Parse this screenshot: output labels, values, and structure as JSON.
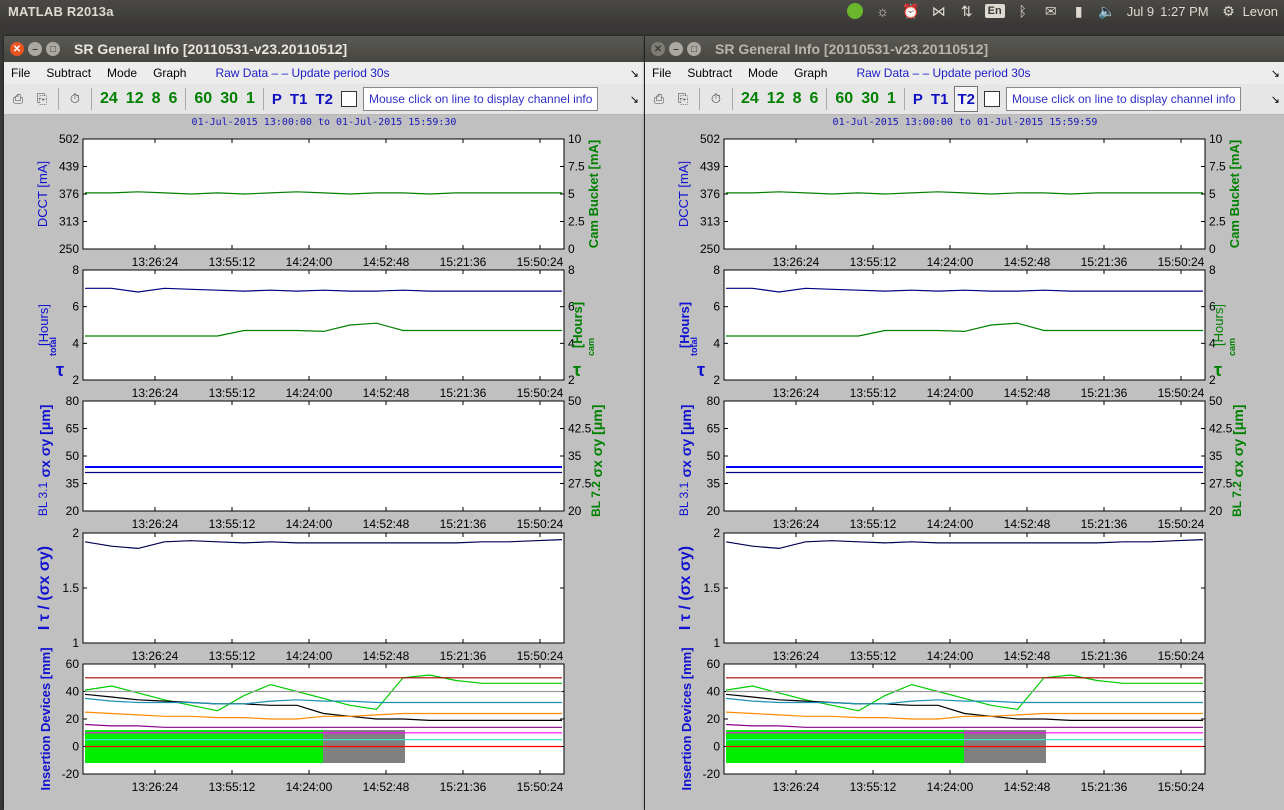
{
  "os": {
    "app_title": "MATLAB R2013a",
    "keyboard_lang": "En",
    "date": "Jul 9",
    "time": "1:27 PM",
    "user": "Levon",
    "tray_icons": [
      "spotify-icon",
      "lightbulb-icon",
      "alarm-clock-icon",
      "network-icon",
      "transfer-icon",
      "keyboard-lang-icon",
      "bluetooth-icon",
      "mail-icon",
      "battery-icon",
      "volume-icon"
    ]
  },
  "windows": [
    {
      "title": "SR General Info [20110531-v23.20110512]",
      "menus": [
        "File",
        "Subtract",
        "Mode",
        "Graph"
      ],
      "raw_label": "Raw Data – – Update period 30s",
      "period_buttons": [
        "24",
        "12",
        "8",
        "6"
      ],
      "refresh_buttons": [
        "60",
        "30",
        "1"
      ],
      "plot_buttons": [
        "P",
        "T1",
        "T2"
      ],
      "info_text": "Mouse click on line to display channel info",
      "date_range": "01-Jul-2015 13:00:00  to  01-Jul-2015 15:59:30"
    },
    {
      "title": "SR General Info [20110531-v23.20110512]",
      "menus": [
        "File",
        "Subtract",
        "Mode",
        "Graph"
      ],
      "raw_label": "Raw Data – – Update period 30s",
      "period_buttons": [
        "24",
        "12",
        "8",
        "6"
      ],
      "refresh_buttons": [
        "60",
        "30",
        "1"
      ],
      "plot_buttons": [
        "P",
        "T1",
        "T2"
      ],
      "info_text": "Mouse click on line to display channel info",
      "date_range": "01-Jul-2015 13:00:00  to  01-Jul-2015 15:59:59"
    }
  ],
  "chart_data": [
    {
      "type": "line",
      "panel": "current",
      "ylabel": "DCCT [mA]",
      "ylabel2": "Cam Bucket [mA]",
      "yticks": [
        "502",
        "439",
        "376",
        "313",
        "250"
      ],
      "yticks2": [
        "10",
        "7.5",
        "5",
        "2.5",
        "0"
      ],
      "ylim": [
        250,
        502
      ],
      "ylim2": [
        0,
        10
      ],
      "xticks": [
        "13:26:24",
        "13:55:12",
        "14:24:00",
        "14:52:48",
        "15:21:36",
        "15:50:24"
      ],
      "series": [
        {
          "axis": "right",
          "color": "#008000",
          "x_min": [
            0,
            180
          ],
          "values": [
            5.1,
            5.1,
            5.2,
            5.1,
            5.0,
            5.1,
            5.0,
            5.1,
            5.2,
            5.1,
            5.0,
            5.1,
            5.1,
            5.0,
            5.1,
            5.1,
            5.1,
            5.1,
            5.1
          ]
        }
      ]
    },
    {
      "type": "line",
      "panel": "lifetime",
      "ylabel": "[Hours]",
      "ylabel_symbol": "τ",
      "ylabel_sub": "total",
      "ylabel2": "[Hours]",
      "ylabel2_symbol": "τ",
      "ylabel2_sub": "cam",
      "yticks": [
        "8",
        "6",
        "4",
        "2"
      ],
      "yticks2": [
        "8",
        "6",
        "4",
        "2"
      ],
      "ylim": [
        2,
        8
      ],
      "xticks": [
        "13:26:24",
        "13:55:12",
        "14:24:00",
        "14:52:48",
        "15:21:36",
        "15:50:24"
      ],
      "series": [
        {
          "axis": "left",
          "color": "#000080",
          "values": [
            7.0,
            7.0,
            6.8,
            7.0,
            6.95,
            6.9,
            6.85,
            6.9,
            6.85,
            6.9,
            6.85,
            6.85,
            6.9,
            6.85,
            6.85,
            6.85,
            6.85,
            6.85,
            6.85
          ]
        },
        {
          "axis": "left",
          "color": "#008000",
          "values": [
            4.4,
            4.4,
            4.4,
            4.4,
            4.4,
            4.4,
            4.7,
            4.7,
            4.7,
            4.65,
            5.0,
            5.1,
            4.7,
            4.7,
            4.7,
            4.7,
            4.7,
            4.7,
            4.7
          ]
        }
      ]
    },
    {
      "type": "line",
      "panel": "beamsize",
      "ylabel": "σx σy [μm]",
      "ylabel_note": "BL 3.1",
      "ylabel2": "σx σy [μm]",
      "ylabel2_note": "BL 7.2",
      "yticks": [
        "80",
        "65",
        "50",
        "35",
        "20"
      ],
      "yticks2": [
        "50",
        "42.5",
        "35",
        "27.5",
        "20"
      ],
      "ylim": [
        20,
        80
      ],
      "xticks": [
        "13:26:24",
        "13:55:12",
        "14:24:00",
        "14:52:48",
        "15:21:36",
        "15:50:24"
      ],
      "series": [
        {
          "axis": "left",
          "color": "#0000ff",
          "values": [
            44,
            44,
            44,
            44,
            44,
            44,
            44,
            44,
            44,
            44,
            44,
            44,
            44,
            44,
            44,
            44,
            44,
            44,
            44
          ]
        },
        {
          "axis": "left",
          "color": "#000080",
          "values": [
            41,
            41,
            41,
            41,
            41,
            41,
            41,
            41,
            41,
            41,
            41,
            41,
            41,
            41,
            41,
            41,
            41,
            41,
            41
          ]
        }
      ]
    },
    {
      "type": "line",
      "panel": "ratio",
      "ylabel": "I τ / (σx σy)",
      "yticks": [
        "2",
        "1.5",
        "1"
      ],
      "ylim": [
        1,
        2
      ],
      "xticks": [
        "13:26:24",
        "13:55:12",
        "14:24:00",
        "14:52:48",
        "15:21:36",
        "15:50:24"
      ],
      "series": [
        {
          "axis": "left",
          "color": "#000050",
          "values": [
            1.92,
            1.88,
            1.86,
            1.92,
            1.93,
            1.92,
            1.91,
            1.92,
            1.91,
            1.91,
            1.91,
            1.91,
            1.91,
            1.91,
            1.91,
            1.92,
            1.92,
            1.93,
            1.94
          ]
        }
      ]
    },
    {
      "type": "line",
      "panel": "insertion-devices",
      "ylabel": "Insertion Devices [mm]",
      "yticks": [
        "60",
        "40",
        "20",
        "0",
        "-20"
      ],
      "ylim": [
        -20,
        60
      ],
      "xticks": [
        "13:26:24",
        "13:55:12",
        "14:24:00",
        "14:52:48",
        "15:21:36",
        "15:50:24"
      ],
      "series": [
        {
          "color": "#00cc00",
          "values": [
            41,
            44,
            39,
            34,
            30,
            26,
            37,
            45,
            40,
            35,
            30,
            27,
            50,
            52,
            48,
            46,
            46,
            46,
            46
          ]
        },
        {
          "color": "#000000",
          "values": [
            38,
            36,
            34,
            33,
            32,
            31,
            31,
            30,
            30,
            24,
            22,
            20,
            20,
            19,
            19,
            19,
            19,
            19,
            19
          ]
        },
        {
          "color": "#ff8c00",
          "values": [
            25,
            24,
            23,
            22,
            22,
            21,
            21,
            20,
            20,
            22,
            22,
            23,
            24,
            24,
            24,
            24,
            24,
            24,
            24
          ]
        },
        {
          "color": "#1f8fb4",
          "values": [
            35,
            33,
            32,
            32,
            32,
            31,
            31,
            33,
            34,
            33,
            33,
            32,
            32,
            32,
            32,
            32,
            32,
            32,
            32
          ]
        },
        {
          "color": "#aa0000",
          "values": [
            50,
            50,
            50,
            50,
            50,
            50,
            50,
            50,
            50,
            50,
            50,
            50,
            50,
            50,
            50,
            50,
            50,
            50,
            50
          ]
        },
        {
          "color": "#880088",
          "values": [
            16,
            15,
            15,
            14,
            14,
            14,
            14,
            14,
            14,
            14,
            14,
            14,
            14,
            14,
            14,
            14,
            14,
            14,
            14
          ]
        },
        {
          "color": "#ff00ff",
          "values": [
            10,
            10,
            10,
            10,
            10,
            10,
            10,
            10,
            10,
            10,
            10,
            10,
            10,
            10,
            10,
            10,
            10,
            10,
            10
          ]
        },
        {
          "color": "#ff0000",
          "values": [
            0,
            0,
            0,
            0,
            0,
            0,
            0,
            0,
            0,
            0,
            0,
            0,
            0,
            0,
            0,
            0,
            0,
            0,
            0
          ]
        },
        {
          "color": "#40e0d0",
          "values": [
            5,
            5,
            5,
            5,
            5,
            5,
            5,
            5,
            5,
            5,
            5,
            5,
            5,
            5,
            5,
            5,
            5,
            5,
            5
          ]
        },
        {
          "color": "#999999",
          "values": [
            40,
            40,
            40,
            40,
            40,
            40,
            40,
            40,
            40,
            40,
            40,
            40,
            40,
            40,
            40,
            40,
            40,
            40,
            40
          ]
        }
      ]
    }
  ]
}
